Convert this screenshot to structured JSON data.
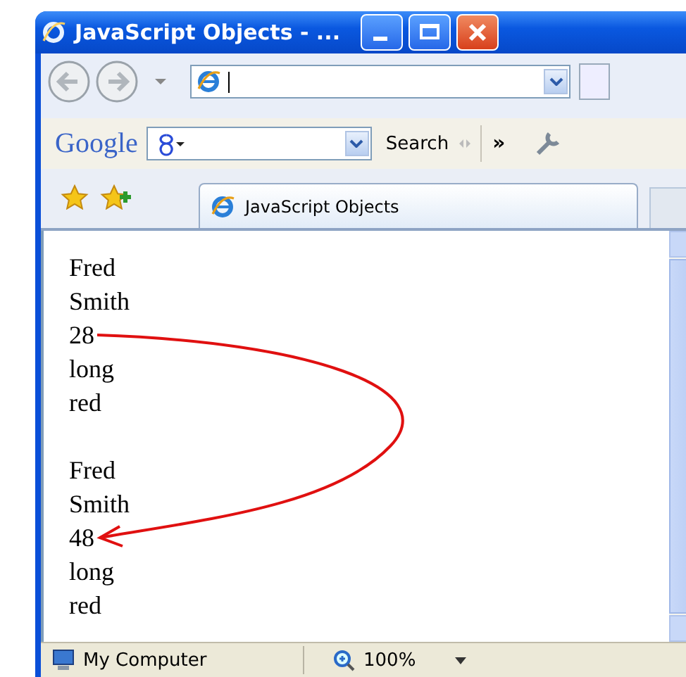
{
  "window": {
    "title": "JavaScript Objects - ..."
  },
  "google_toolbar": {
    "logo": "Google",
    "search_button": "Search",
    "more": "»"
  },
  "tabs": [
    {
      "label": "JavaScript Objects",
      "selected": true
    }
  ],
  "content": {
    "lines": [
      {
        "text": "Fred"
      },
      {
        "text": "Smith"
      },
      {
        "text": "28",
        "arrow_start": true
      },
      {
        "text": "long"
      },
      {
        "text": "red"
      },
      {
        "text": "Fred",
        "gap_before": true
      },
      {
        "text": "Smith"
      },
      {
        "text": "48",
        "arrow_end": true
      },
      {
        "text": "long"
      },
      {
        "text": "red"
      }
    ],
    "annotation": {
      "kind": "curved-arrow",
      "color": "#e01010"
    }
  },
  "status_bar": {
    "zone": "My Computer",
    "zoom": "100%"
  }
}
